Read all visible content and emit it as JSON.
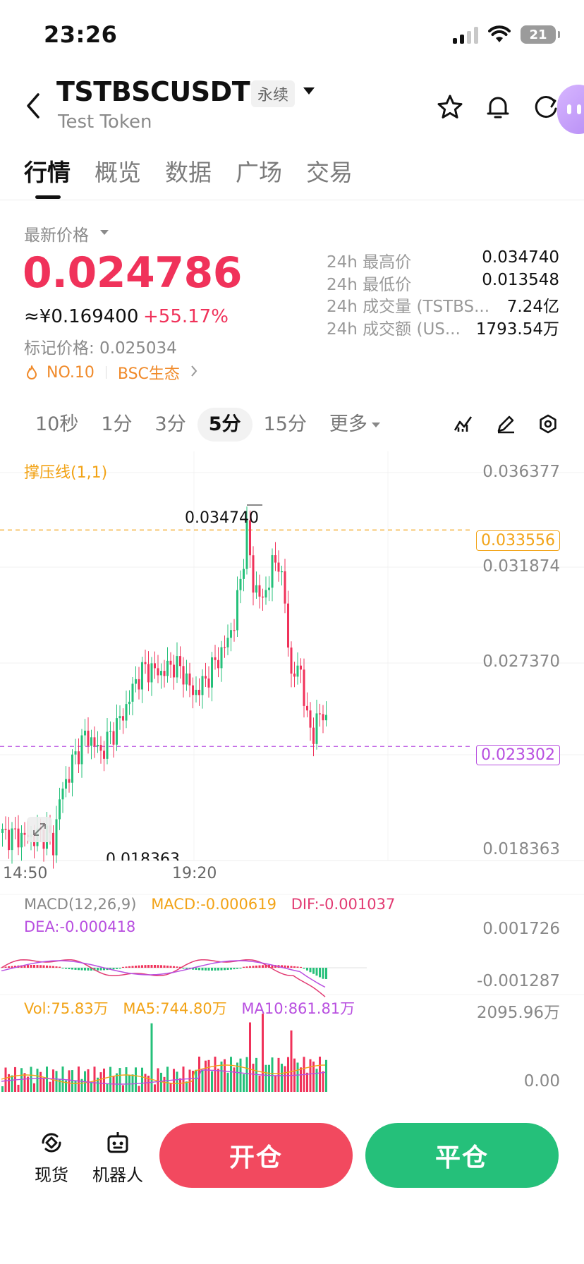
{
  "status_bar": {
    "time": "23:26",
    "battery": "21"
  },
  "header": {
    "symbol": "TSTBSCUSDT",
    "contract_type": "永续",
    "token_name": "Test Token"
  },
  "tabs": [
    {
      "label": "行情",
      "active": true
    },
    {
      "label": "概览",
      "active": false
    },
    {
      "label": "数据",
      "active": false
    },
    {
      "label": "广场",
      "active": false
    },
    {
      "label": "交易",
      "active": false
    }
  ],
  "price": {
    "latest_label": "最新价格",
    "last": "0.024786",
    "cny": "≈¥0.169400",
    "change": "+55.17%",
    "mark": "标记价格: 0.025034",
    "rank": "NO.10",
    "sector": "BSC生态"
  },
  "stats": [
    {
      "label": "24h 最高价",
      "value": "0.034740"
    },
    {
      "label": "24h 最低价",
      "value": "0.013548"
    },
    {
      "label": "24h 成交量 (TSTBS...",
      "value": "7.24亿"
    },
    {
      "label": "24h 成交额 (US...",
      "value": "1793.54万"
    }
  ],
  "intervals": [
    {
      "label": "10秒",
      "active": false
    },
    {
      "label": "1分",
      "active": false
    },
    {
      "label": "3分",
      "active": false
    },
    {
      "label": "5分",
      "active": true
    },
    {
      "label": "15分",
      "active": false
    },
    {
      "label": "更多",
      "active": false
    }
  ],
  "chart": {
    "indicator_label": "撑压线(1,1)",
    "y_axis": [
      "0.036377",
      "0.031874",
      "0.027370",
      "0.018363"
    ],
    "resistance": "0.033556",
    "support": "0.023302",
    "high_marker": "0.034740",
    "low_marker": "0.018363",
    "x_axis": [
      "14:50",
      "19:20"
    ],
    "colors": {
      "up": "#25c07a",
      "down": "#f0325a",
      "resistance": "#f2a316",
      "support": "#b84fe0"
    }
  },
  "macd": {
    "title": "MACD(12,26,9)",
    "macd": "MACD:-0.000619",
    "dif": "DIF:-0.001037",
    "dea": "DEA:-0.000418",
    "axis_top": "0.001726",
    "axis_bottom": "-0.001287"
  },
  "volume": {
    "vol": "Vol:75.83万",
    "ma5": "MA5:744.80万",
    "ma10": "MA10:861.81万",
    "axis_top": "2095.96万",
    "axis_bottom": "0.00"
  },
  "bottom": {
    "spot": "现货",
    "bot": "机器人",
    "open": "开仓",
    "close": "平仓"
  }
}
